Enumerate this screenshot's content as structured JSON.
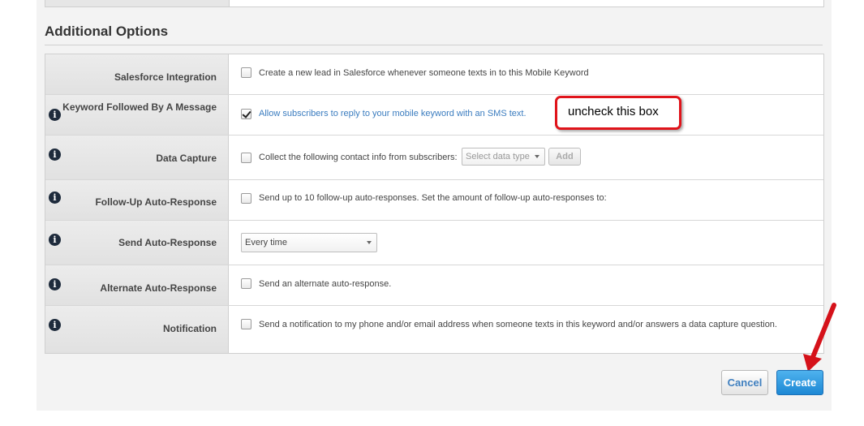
{
  "section": {
    "title": "Additional Options"
  },
  "options": [
    {
      "label": "Salesforce Integration",
      "has_info": false,
      "checked": false,
      "text": "Create a new lead in Salesforce whenever someone texts in to this Mobile Keyword"
    },
    {
      "label": "Keyword Followed By A Message",
      "has_info": true,
      "checked": true,
      "text": "Allow subscribers to reply to your mobile keyword with an SMS text."
    },
    {
      "label": "Data Capture",
      "has_info": true,
      "checked": false,
      "text": "Collect the following contact info from subscribers:",
      "select_placeholder": "Select data type",
      "add_label": "Add"
    },
    {
      "label": "Follow-Up Auto-Response",
      "has_info": true,
      "checked": false,
      "text": "Send up to 10 follow-up auto-responses. Set the amount of follow-up auto-responses to:"
    },
    {
      "label": "Send Auto-Response",
      "has_info": true,
      "select_value": "Every time"
    },
    {
      "label": "Alternate Auto-Response",
      "has_info": true,
      "checked": false,
      "text": "Send an alternate auto-response."
    },
    {
      "label": "Notification",
      "has_info": true,
      "checked": false,
      "text": "Send a notification to my phone and/or email address when someone texts in this keyword and/or answers a data capture question."
    }
  ],
  "annotation": {
    "callout_text": "uncheck this box",
    "color": "#e0141b"
  },
  "actions": {
    "cancel_label": "Cancel",
    "create_label": "Create"
  },
  "icons": {
    "info": "info-circle-icon",
    "select_caret": "chevron-down-icon",
    "arrow": "red-arrow-icon"
  },
  "colors": {
    "link_text": "#3a7cbf",
    "create_button": "#1d88d4",
    "info_icon": "#1e2b3c"
  }
}
